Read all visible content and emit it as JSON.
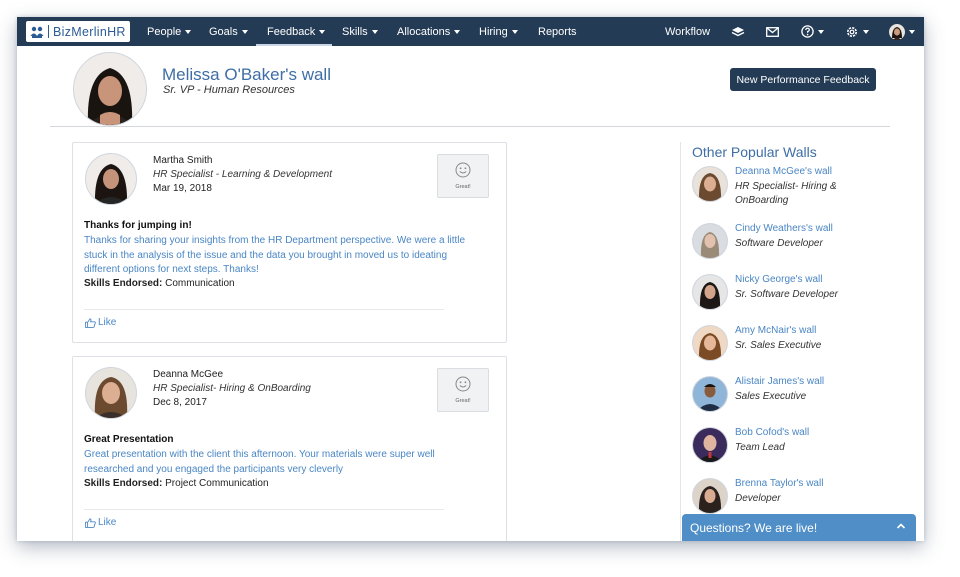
{
  "app": {
    "logo_text": "BizMerlinHR"
  },
  "nav": {
    "items": [
      {
        "label": "People"
      },
      {
        "label": "Goals"
      },
      {
        "label": "Feedback"
      },
      {
        "label": "Skills"
      },
      {
        "label": "Allocations"
      },
      {
        "label": "Hiring"
      },
      {
        "label": "Reports"
      }
    ],
    "right": {
      "workflow_label": "Workflow"
    },
    "active_item": "Feedback"
  },
  "profile": {
    "wall_title": "Melissa O'Baker's wall",
    "subtitle": "Sr. VP - Human Resources",
    "new_feedback_button": "New Performance Feedback"
  },
  "feed": [
    {
      "author": "Martha Smith",
      "role": "HR Specialist - Learning & Development",
      "date": "Mar 19, 2018",
      "badge": "Great!",
      "title": "Thanks for jumping in!",
      "body": "Thanks for sharing your insights from the HR Department perspective. We were a little stuck in the analysis of the issue and the data you brought in moved us to ideating different options for next steps. Thanks!",
      "skills_label": "Skills Endorsed:",
      "skills": "Communication",
      "like_label": "Like"
    },
    {
      "author": "Deanna McGee",
      "role": "HR Specialist- Hiring & OnBoarding",
      "date": "Dec 8, 2017",
      "badge": "Great!",
      "title": "Great Presentation",
      "body": "Great presentation with the client this afternoon. Your materials were super well researched and you engaged the participants very cleverly",
      "skills_label": "Skills Endorsed:",
      "skills": "Project Communication",
      "like_label": "Like"
    }
  ],
  "popular": {
    "title": "Other Popular Walls",
    "walls": [
      {
        "link": "Deanna McGee's wall",
        "role": "HR Specialist- Hiring & OnBoarding"
      },
      {
        "link": "Cindy Weathers's wall",
        "role": "Software Developer"
      },
      {
        "link": "Nicky George's wall",
        "role": "Sr. Software Developer"
      },
      {
        "link": "Amy McNair's wall",
        "role": "Sr. Sales Executive"
      },
      {
        "link": "Alistair James's wall",
        "role": "Sales Executive"
      },
      {
        "link": "Bob Cofod's wall",
        "role": "Team Lead"
      },
      {
        "link": "Brenna Taylor's wall",
        "role": "Developer"
      }
    ]
  },
  "chat": {
    "label": "Questions? We are live!"
  },
  "colors": {
    "nav_bg": "#243b55",
    "link": "#4a86c4",
    "heading": "#3e6ea5",
    "chat_bg": "#4f8ec6"
  }
}
